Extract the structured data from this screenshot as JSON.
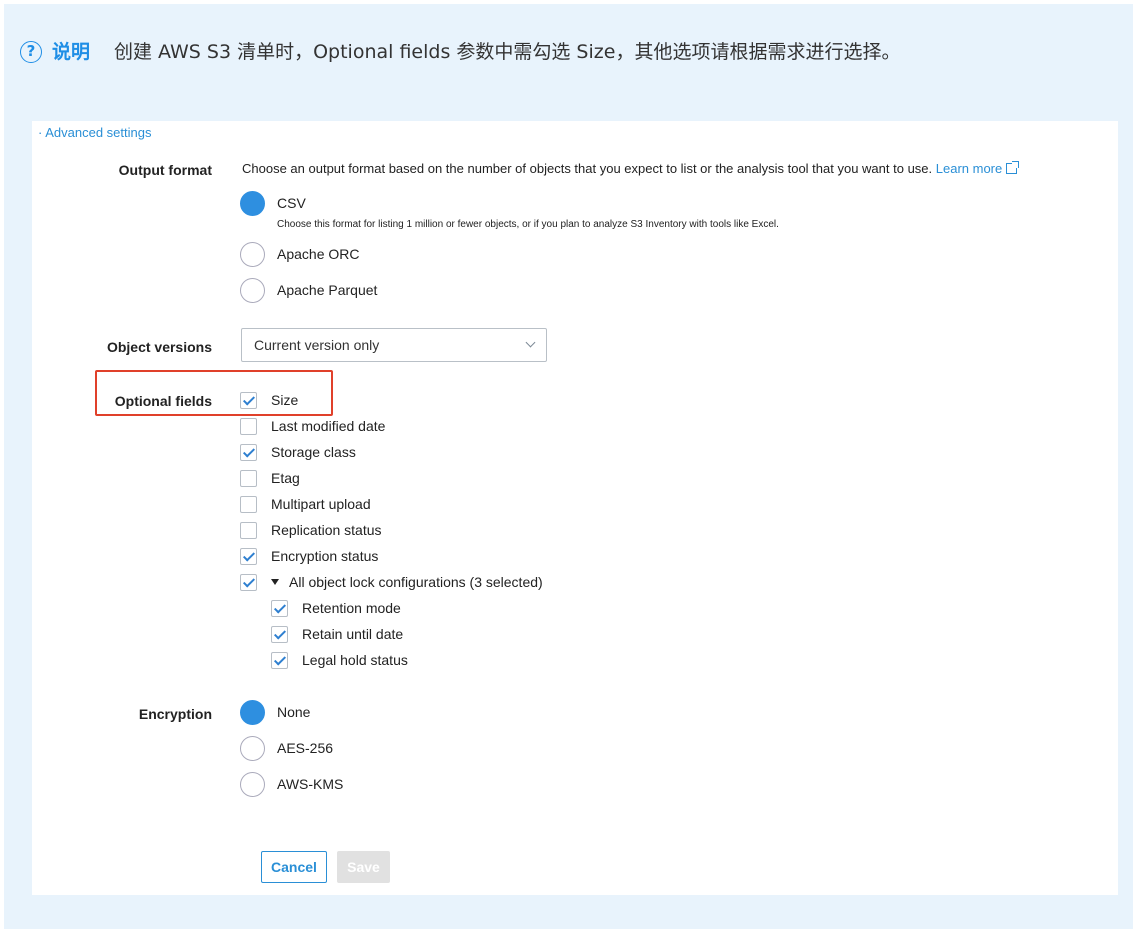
{
  "note": {
    "label": "说明",
    "text": "创建 AWS S3 清单时，Optional fields 参数中需勾选 Size，其他选项请根据需求进行选择。"
  },
  "advanced_link": "· Advanced settings",
  "output_format": {
    "label": "Output format",
    "description": "Choose an output format based on the number of objects that you expect to list or the analysis tool that you want to use.",
    "learn_more": "Learn more",
    "options": [
      {
        "label": "CSV",
        "selected": true,
        "sub": "Choose this format for listing 1 million or fewer objects, or if you plan to analyze S3 Inventory with tools like Excel."
      },
      {
        "label": "Apache ORC",
        "selected": false
      },
      {
        "label": "Apache Parquet",
        "selected": false
      }
    ]
  },
  "object_versions": {
    "label": "Object versions",
    "value": "Current version only"
  },
  "optional_fields": {
    "label": "Optional fields",
    "items": [
      {
        "label": "Size",
        "checked": true
      },
      {
        "label": "Last modified date",
        "checked": false
      },
      {
        "label": "Storage class",
        "checked": true
      },
      {
        "label": "Etag",
        "checked": false
      },
      {
        "label": "Multipart upload",
        "checked": false
      },
      {
        "label": "Replication status",
        "checked": false
      },
      {
        "label": "Encryption status",
        "checked": true
      },
      {
        "label": "All object lock configurations (3 selected)",
        "checked": true
      },
      {
        "label": "Retention mode",
        "checked": true
      },
      {
        "label": "Retain until date",
        "checked": true
      },
      {
        "label": "Legal hold status",
        "checked": true
      }
    ]
  },
  "encryption": {
    "label": "Encryption",
    "options": [
      {
        "label": "None",
        "selected": true
      },
      {
        "label": "AES-256",
        "selected": false
      },
      {
        "label": "AWS-KMS",
        "selected": false
      }
    ]
  },
  "buttons": {
    "cancel": "Cancel",
    "save": "Save"
  },
  "colors": {
    "accent": "#2e8fe0",
    "highlight": "#e0402a",
    "note_bg": "#e8f3fc"
  }
}
